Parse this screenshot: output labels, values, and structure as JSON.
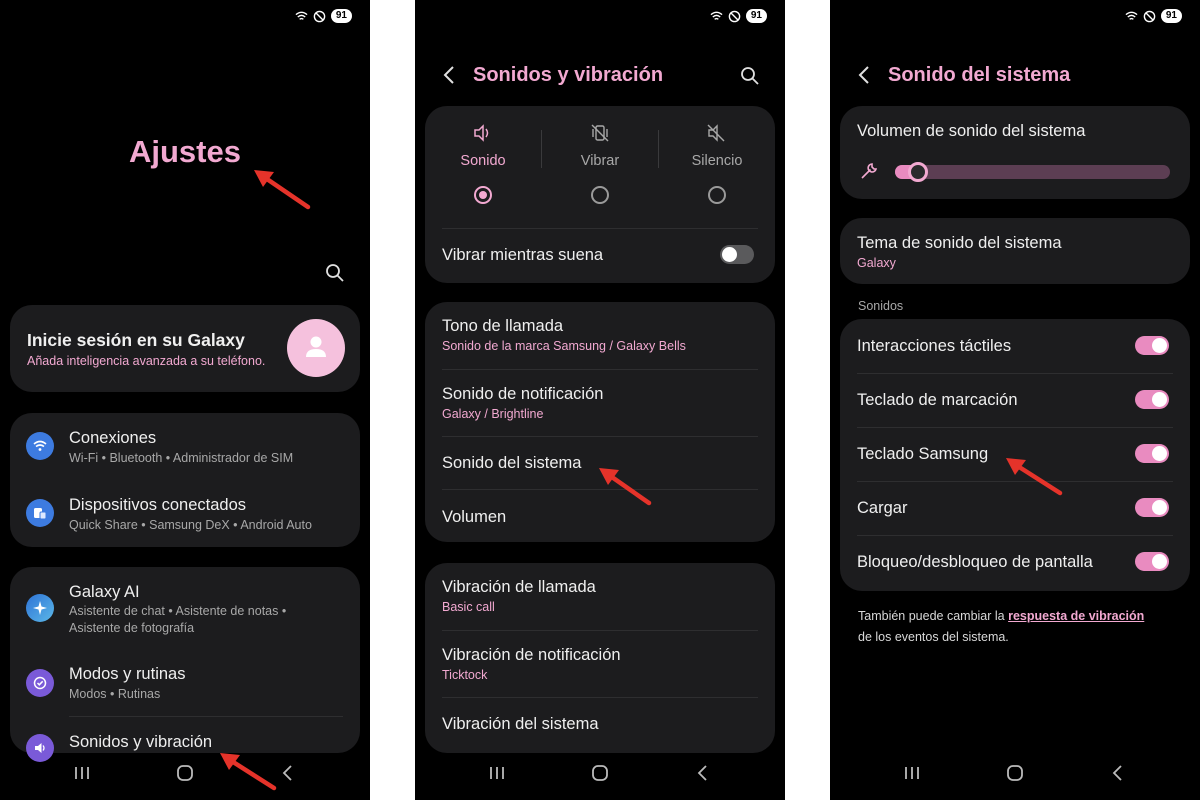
{
  "status": {
    "battery": "91"
  },
  "settings": {
    "title": "Ajustes",
    "account": {
      "title": "Inicie sesión en su Galaxy",
      "subtitle": "Añada inteligencia avanzada a su teléfono."
    },
    "items": [
      {
        "title": "Conexiones",
        "sub": "Wi-Fi  •  Bluetooth  •  Administrador de SIM",
        "icon": "wifi-icon",
        "color": "#3d7be0"
      },
      {
        "title": "Dispositivos conectados",
        "sub": "Quick Share  •  Samsung DeX  •  Android Auto",
        "icon": "devices-icon",
        "color": "#3d7be0"
      },
      {
        "title": "Galaxy AI",
        "sub": "Asistente de chat  •  Asistente de notas  •",
        "sub2": "Asistente de fotografía",
        "icon": "sparkle-icon",
        "color": "#2e73d6"
      },
      {
        "title": "Modos y rutinas",
        "sub": "Modos  •  Rutinas",
        "icon": "modes-icon",
        "color": "#7a5ad8"
      },
      {
        "title": "Sonidos y vibración",
        "icon": "sound-icon",
        "color": "#7a5ad8"
      }
    ]
  },
  "sounds": {
    "header": "Sonidos y vibración",
    "modes": [
      {
        "label": "Sonido",
        "icon": "volume-icon",
        "selected": true
      },
      {
        "label": "Vibrar",
        "icon": "vibrate-icon",
        "selected": false
      },
      {
        "label": "Silencio",
        "icon": "mute-icon",
        "selected": false
      }
    ],
    "vibrate_while_ringing": {
      "label": "Vibrar mientras suena",
      "on": false
    },
    "group1": [
      {
        "title": "Tono de llamada",
        "sub": "Sonido de la marca Samsung / Galaxy Bells"
      },
      {
        "title": "Sonido de notificación",
        "sub": "Galaxy / Brightline"
      },
      {
        "title": "Sonido del sistema"
      },
      {
        "title": "Volumen"
      }
    ],
    "group2": [
      {
        "title": "Vibración de llamada",
        "sub": "Basic call"
      },
      {
        "title": "Vibración de notificación",
        "sub": "Ticktock"
      },
      {
        "title": "Vibración del sistema"
      }
    ]
  },
  "system_sound": {
    "header": "Sonido del sistema",
    "volume": {
      "label": "Volumen de sonido del sistema",
      "level": 0.05
    },
    "theme": {
      "title": "Tema de sonido del sistema",
      "value": "Galaxy"
    },
    "section_label": "Sonidos",
    "toggles": [
      {
        "label": "Interacciones táctiles",
        "on": true
      },
      {
        "label": "Teclado de marcación",
        "on": true
      },
      {
        "label": "Teclado Samsung",
        "on": true
      },
      {
        "label": "Cargar",
        "on": true
      },
      {
        "label": "Bloqueo/desbloqueo de pantalla",
        "on": true
      }
    ],
    "footer_text": "También puede cambiar la",
    "footer_link": "respuesta de vibración",
    "footer_text2": "de los eventos del sistema."
  },
  "colors": {
    "accent": "#f2a9d1",
    "toggle_on": "#e98bc0",
    "arrow": "#e5332a",
    "card": "#1c1c1e"
  }
}
